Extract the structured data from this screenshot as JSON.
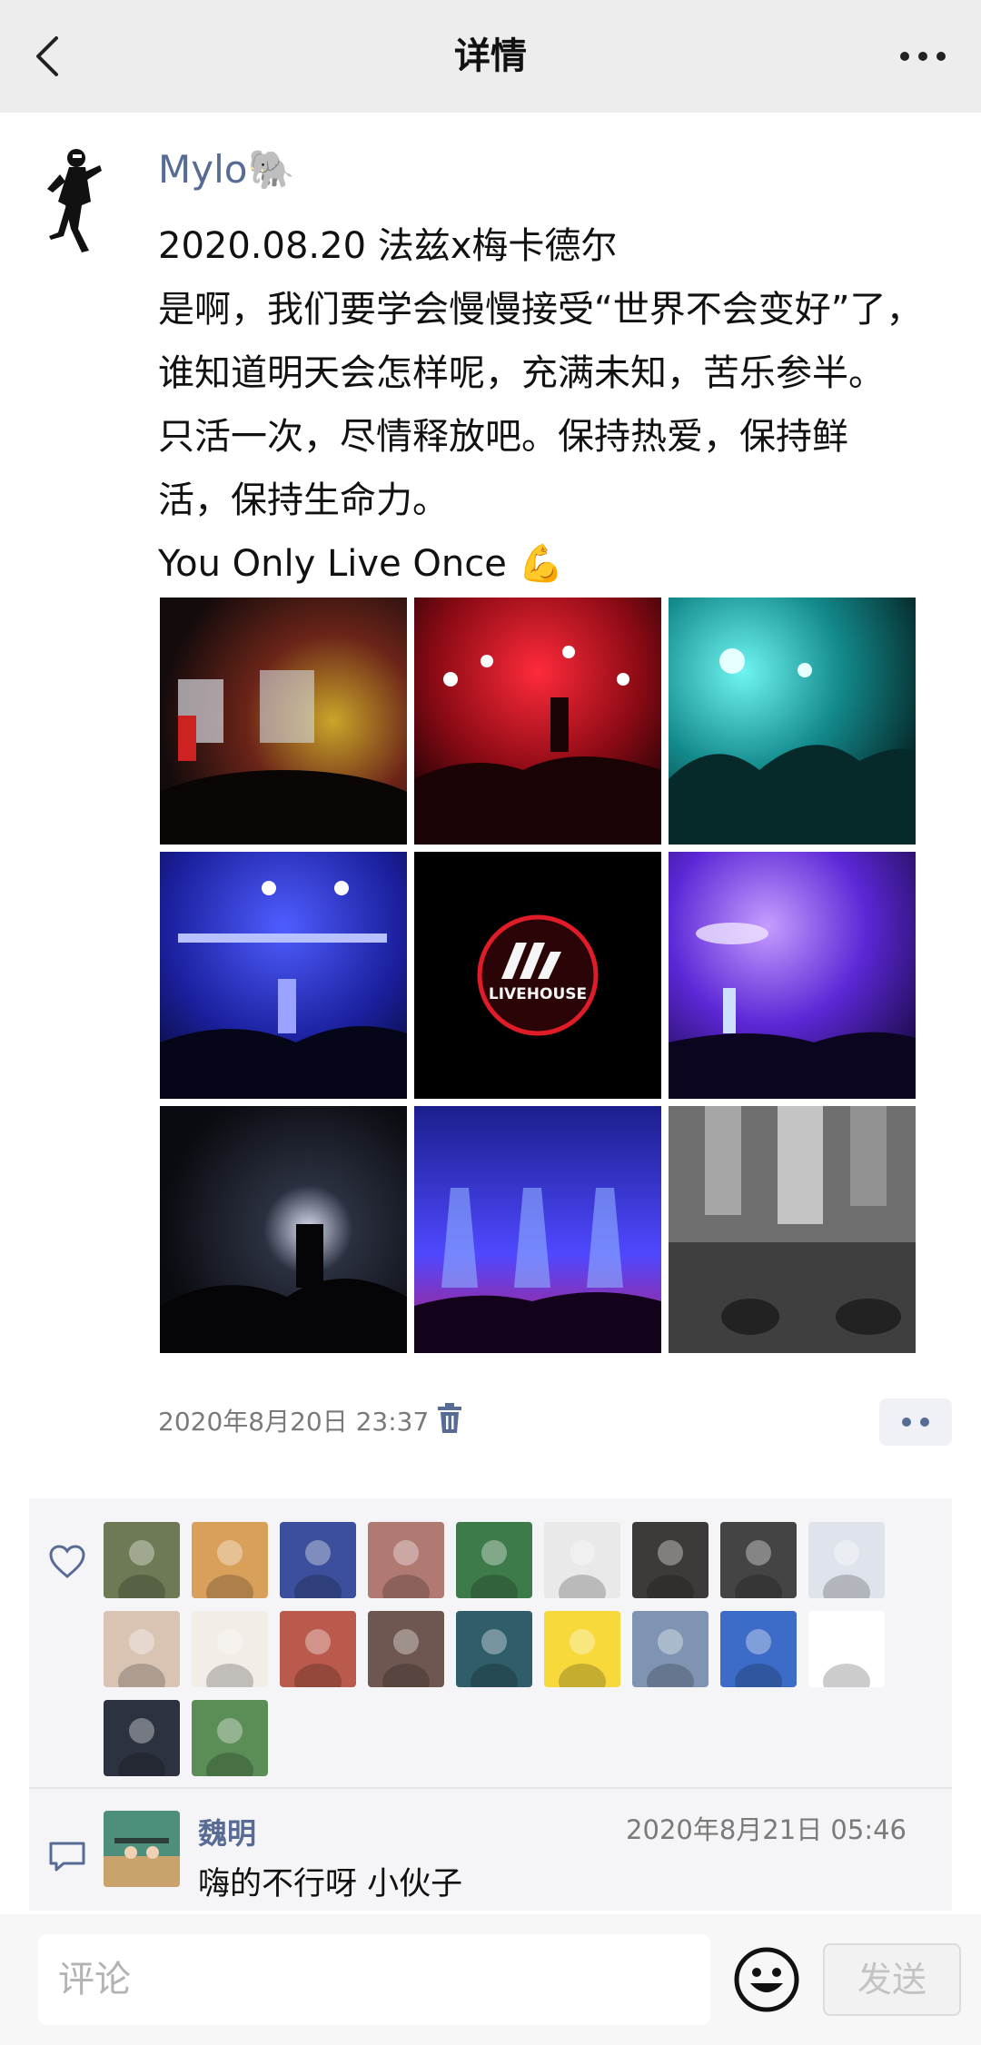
{
  "header": {
    "title": "详情",
    "back_icon": "chevron-left-icon",
    "more_icon": "more-dots-icon"
  },
  "post": {
    "author": "Mylo🐘",
    "lines": [
      "2020.08.20 法兹x梅卡德尔",
      "是啊，我们要学会慢慢接受“世界不会变好”了，",
      "谁知道明天会怎样呢，充满未知，苦乐参半。",
      "只活一次，尽情释放吧。保持热爱，保持鲜",
      "活，保持生命力。",
      "You Only Live Once 💪"
    ],
    "photos": [
      {
        "label": "stage-red-yellow-lights"
      },
      {
        "label": "red-lights-crowd"
      },
      {
        "label": "cyan-lights-crowd"
      },
      {
        "label": "blue-stage-performer"
      },
      {
        "label": "livehouse-logo",
        "logo_text": "LIVEHOUSE"
      },
      {
        "label": "purple-stage-band"
      },
      {
        "label": "dark-stage-silhouette"
      },
      {
        "label": "blue-beams-crowd"
      },
      {
        "label": "dance-floor-feet"
      }
    ],
    "timestamp": "2020年8月20日 23:37",
    "delete_icon": "trash-icon"
  },
  "likes": {
    "icon": "heart-outline-icon",
    "avatars": [
      {
        "color": "#6d7a55"
      },
      {
        "color": "#d8a05a"
      },
      {
        "color": "#3b4f9c"
      },
      {
        "color": "#b07a72"
      },
      {
        "color": "#3e7b4a"
      },
      {
        "color": "#e9e9e9"
      },
      {
        "color": "#3d3b3a"
      },
      {
        "color": "#444"
      },
      {
        "color": "#dfe3ec"
      },
      {
        "color": "#d9c4b4"
      },
      {
        "color": "#f2ede6"
      },
      {
        "color": "#b95a4c"
      },
      {
        "color": "#6e5750"
      },
      {
        "color": "#2f5d6a"
      },
      {
        "color": "#f7d93b"
      },
      {
        "color": "#7f94b2"
      },
      {
        "color": "#3c6cc7"
      },
      {
        "color": "#fff"
      },
      {
        "color": "#2c3240"
      },
      {
        "color": "#5b8d57"
      }
    ]
  },
  "comments": [
    {
      "icon": "comment-bubble-icon",
      "author": "魏明",
      "time": "2020年8月21日 05:46",
      "text": "嗨的不行呀 小伙子"
    }
  ],
  "composer": {
    "placeholder": "评论",
    "emoji_icon": "smiley-icon",
    "send_label": "发送"
  }
}
